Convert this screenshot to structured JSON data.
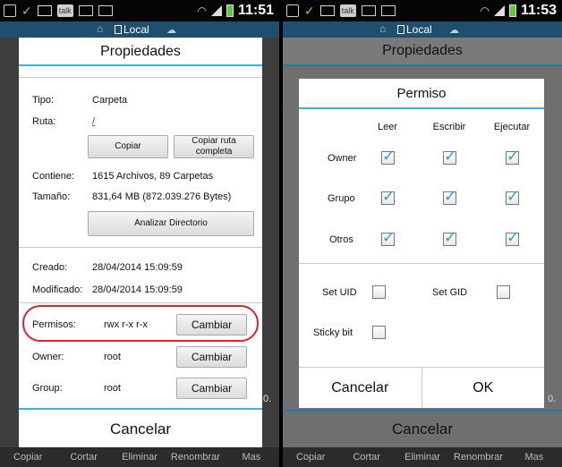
{
  "status": {
    "time_left": "11:51",
    "time_right": "11:53",
    "talk": "talk"
  },
  "app": {
    "location": "Local"
  },
  "toolbar": {
    "items": [
      "Copiar",
      "Cortar",
      "Eliminar",
      "Renombrar",
      "Mas"
    ]
  },
  "props_dialog": {
    "title": "Propiedades",
    "tipo_label": "Tipo:",
    "tipo_value": "Carpeta",
    "ruta_label": "Ruta:",
    "ruta_value": "/",
    "copy_button": "Copiar",
    "copy_full_button": "Copiar ruta completa",
    "contiene_label": "Contiene:",
    "contiene_value": "1615 Archivos, 89 Carpetas",
    "tamano_label": "Tamaño:",
    "tamano_value": "831,64 MB (872.039.276 Bytes)",
    "analyze_button": "Analizar Directorio",
    "creado_label": "Creado:",
    "creado_value": "28/04/2014 15:09:59",
    "modificado_label": "Modificado:",
    "modificado_value": "28/04/2014 15:09:59",
    "permisos_label": "Permisos:",
    "permisos_value": "rwx r-x r-x",
    "owner_label": "Owner:",
    "owner_value": "root",
    "group_label": "Group:",
    "group_value": "root",
    "change_button": "Cambiar",
    "cancel": "Cancelar",
    "edge_text": "0."
  },
  "perm_dialog": {
    "bg_title": "Propiedades",
    "title": "Permiso",
    "cols": [
      "Leer",
      "Escribir",
      "Ejecutar"
    ],
    "rows": [
      "Owner",
      "Grupo",
      "Otros"
    ],
    "set_uid": "Set UID",
    "set_gid": "Set GID",
    "sticky": "Sticky bit",
    "cancel": "Cancelar",
    "ok": "OK",
    "bg_cancel": "Cancelar",
    "edge_text": "0."
  },
  "accent_color": "#35b5e5",
  "highlight_color": "#e3232a"
}
